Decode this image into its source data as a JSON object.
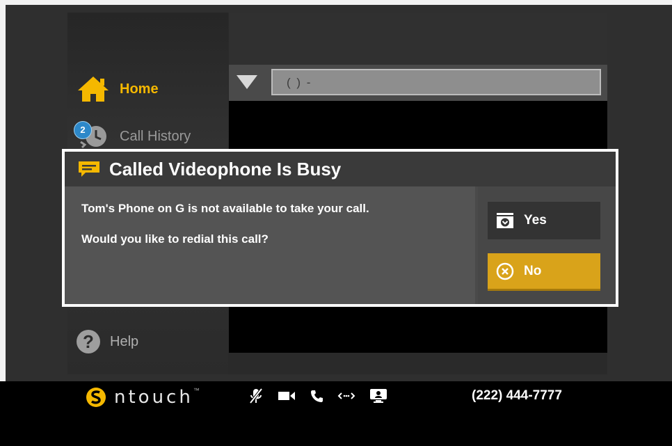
{
  "sidebar": {
    "items": [
      {
        "label": "Home",
        "icon": "home-icon"
      },
      {
        "label": "Call History",
        "icon": "clock-icon",
        "badge": "2"
      },
      {
        "label": "Help",
        "icon": "help-icon"
      }
    ]
  },
  "dialer": {
    "value": "(   )   -"
  },
  "dialog": {
    "title": "Called Videophone Is Busy",
    "message": "Tom's Phone on G is not available to take your call.",
    "question": "Would you like to redial this call?",
    "yes_label": "Yes",
    "no_label": "No"
  },
  "bottom_bar": {
    "brand": "ntouch",
    "brand_tm": "™",
    "phone_number": "(222) 444-7777",
    "status_icons": [
      "mic-muted-icon",
      "video-camera-icon",
      "phone-icon",
      "transfer-icon",
      "monitor-icon"
    ]
  },
  "colors": {
    "accent": "#f5b800",
    "button_no": "#d9a31a",
    "badge": "#2d88c9"
  }
}
